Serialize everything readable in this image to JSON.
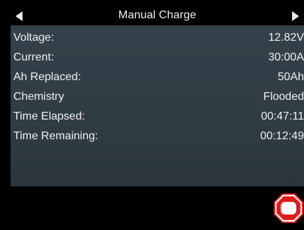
{
  "header": {
    "title": "Manual Charge",
    "left_icon": "left-arrow-icon",
    "right_icon": "right-arrow-icon"
  },
  "readings": [
    {
      "label": "Voltage:",
      "value": "12.82V"
    },
    {
      "label": "Current:",
      "value": "30:00A"
    },
    {
      "label": "Ah Replaced:",
      "value": "50Ah"
    },
    {
      "label": "Chemistry",
      "value": "Flooded"
    },
    {
      "label": "Time Elapsed:",
      "value": "00:47:11"
    },
    {
      "label": "Time Remaining:",
      "value": "00:12:49"
    }
  ],
  "footer": {
    "stop_icon": "stop-icon",
    "stop_color": "#e31b1b"
  },
  "colors": {
    "panel": "#34414a",
    "text": "#f0f0f0",
    "background": "#000000"
  }
}
